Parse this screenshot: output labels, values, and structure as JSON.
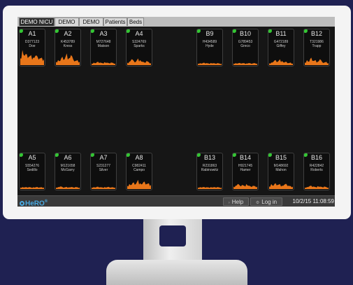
{
  "tabs": [
    "DEMO NICU",
    "DEMO A",
    "DEMO B",
    "Patients",
    "Beds"
  ],
  "active_tab": 0,
  "top_beds": [
    {
      "bed": "A1",
      "mrn": "D377123",
      "name": "Doe",
      "trend": [
        0.4,
        0.9,
        0.55,
        0.65,
        0.5,
        0.6,
        0.45,
        0.55,
        0.5,
        0.4,
        0.45,
        0.35
      ]
    },
    {
      "bed": "A2",
      "mrn": "K453789",
      "name": "Kress",
      "trend": [
        0.2,
        0.3,
        0.25,
        0.5,
        0.35,
        0.7,
        0.4,
        0.6,
        0.35,
        0.25,
        0.3,
        0.2
      ]
    },
    {
      "bed": "A3",
      "mrn": "M727648",
      "name": "Matson",
      "trend": [
        0.1,
        0.15,
        0.12,
        0.2,
        0.15,
        0.12,
        0.18,
        0.14,
        0.12,
        0.16,
        0.13,
        0.1
      ]
    },
    {
      "bed": "A4",
      "mrn": "S324769",
      "name": "Sparks",
      "trend": [
        0.15,
        0.2,
        0.35,
        0.25,
        0.2,
        0.4,
        0.3,
        0.2,
        0.15,
        0.25,
        0.18,
        0.12
      ]
    },
    {
      "bed": "B9",
      "mrn": "H434589",
      "name": "Hyde",
      "trend": [
        0.1,
        0.12,
        0.1,
        0.14,
        0.12,
        0.1,
        0.13,
        0.11,
        0.1,
        0.12,
        0.1,
        0.09
      ]
    },
    {
      "bed": "B10",
      "mrn": "G789453",
      "name": "Greco",
      "trend": [
        0.1,
        0.12,
        0.1,
        0.13,
        0.11,
        0.12,
        0.1,
        0.12,
        0.1,
        0.11,
        0.12,
        0.1
      ]
    },
    {
      "bed": "B11",
      "mrn": "G472189",
      "name": "Giffey",
      "trend": [
        0.12,
        0.15,
        0.2,
        0.3,
        0.2,
        0.35,
        0.25,
        0.15,
        0.2,
        0.12,
        0.15,
        0.1
      ]
    },
    {
      "bed": "B12",
      "mrn": "T321986",
      "name": "Trapp",
      "trend": [
        0.15,
        0.3,
        0.2,
        0.45,
        0.25,
        0.3,
        0.2,
        0.35,
        0.2,
        0.15,
        0.2,
        0.12
      ]
    }
  ],
  "bottom_beds": [
    {
      "bed": "A5",
      "mrn": "S554276",
      "name": "Sedillo",
      "trend": [
        0.1,
        0.12,
        0.1,
        0.11,
        0.12,
        0.1,
        0.11,
        0.1,
        0.12,
        0.1,
        0.11,
        0.1
      ]
    },
    {
      "bed": "A6",
      "mrn": "M121658",
      "name": "McGarry",
      "trend": [
        0.1,
        0.12,
        0.15,
        0.12,
        0.1,
        0.13,
        0.11,
        0.12,
        0.1,
        0.12,
        0.11,
        0.1
      ]
    },
    {
      "bed": "A7",
      "mrn": "S231277",
      "name": "Silver",
      "trend": [
        0.1,
        0.12,
        0.1,
        0.14,
        0.11,
        0.1,
        0.12,
        0.1,
        0.13,
        0.1,
        0.11,
        0.1
      ]
    },
    {
      "bed": "A8",
      "mrn": "C982411",
      "name": "Campo",
      "trend": [
        0.2,
        0.3,
        0.25,
        0.4,
        0.3,
        0.55,
        0.35,
        0.3,
        0.45,
        0.3,
        0.35,
        0.25
      ]
    },
    {
      "bed": "B13",
      "mrn": "R231863",
      "name": "Rabinowitz",
      "trend": [
        0.1,
        0.12,
        0.1,
        0.12,
        0.11,
        0.1,
        0.12,
        0.1,
        0.11,
        0.12,
        0.1,
        0.1
      ]
    },
    {
      "bed": "B14",
      "mrn": "H921745",
      "name": "Hamer",
      "trend": [
        0.15,
        0.2,
        0.3,
        0.2,
        0.25,
        0.2,
        0.3,
        0.2,
        0.15,
        0.2,
        0.18,
        0.15
      ]
    },
    {
      "bed": "B15",
      "mrn": "M148692",
      "name": "Mahon",
      "trend": [
        0.15,
        0.3,
        0.2,
        0.35,
        0.25,
        0.3,
        0.2,
        0.25,
        0.3,
        0.2,
        0.18,
        0.15
      ]
    },
    {
      "bed": "B16",
      "mrn": "R422842",
      "name": "Roberts",
      "trend": [
        0.1,
        0.12,
        0.15,
        0.2,
        0.15,
        0.12,
        0.18,
        0.14,
        0.12,
        0.15,
        0.12,
        0.1
      ]
    }
  ],
  "footer": {
    "logo": "HeRO",
    "logo_mark": "®",
    "help_label": "Help",
    "login_label": "Log in",
    "datetime": "10/2/15 11:08:59"
  },
  "colors": {
    "trend": "#e8761a",
    "status_dot": "#34c634",
    "logo": "#49a9e0"
  }
}
